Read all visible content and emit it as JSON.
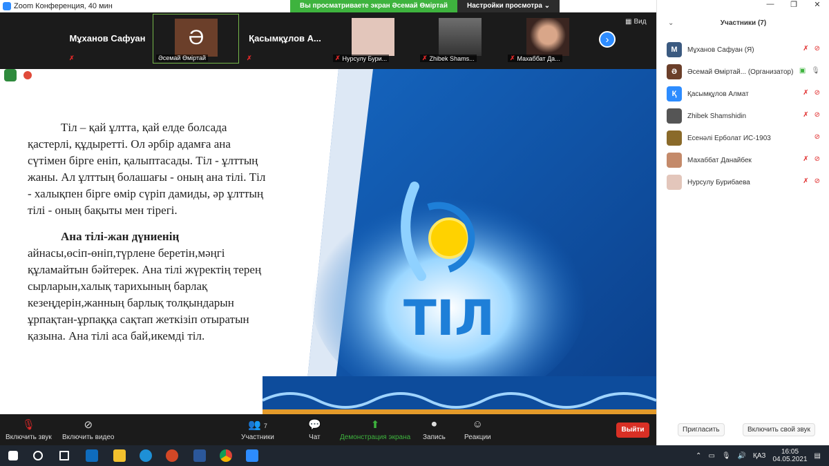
{
  "window": {
    "title": "Zoom Конференция, 40 мин",
    "share_notice": "Вы просматриваете экран Әсемай Өміртай",
    "view_settings": "Настройки просмотра",
    "view_label": "Вид"
  },
  "tiles": [
    {
      "name": "Мұханов Сафуан",
      "label": ""
    },
    {
      "label": "Әсемай Өміртай",
      "avatar": "Ә"
    },
    {
      "name": "Қасымқұлов А...",
      "label": ""
    },
    {
      "label": "Нурсулу Бури..."
    },
    {
      "label": "Zhibek Shams..."
    },
    {
      "label": "Махаббат Да..."
    }
  ],
  "slide": {
    "paragraph1": "Тіл – қай ұлтта, қай елде болсада қастерлі, құдыретті. Ол әрбір адамға ана сүтімен бірге еніп, қалыптасады.    Тіл - ұлттың жаны. Ал ұлттың болашағы - оның ана тілі. Тіл - халықпен бірге өмір сүріп дамиды, әр ұлттың тілі - оның бақыты мен тірегі.",
    "paragraph2_bold": "Ана тілі-жан дүниенің",
    "paragraph2_rest": "айнасы,өсіп-өніп,түрлене беретін,мәңгі құламайтын бәйтерек. Ана тілі жүректің терең сырларын,халық тарихының барлақ кезеңдерін,жанның барлық толқындарын ұрпақтан-ұрпаққа сақтап жеткізіп отыратын қазына. Ана тілі аса бай,икемді тіл.",
    "logo_text": "ТІЛ"
  },
  "toolbar": {
    "mute": "Включить звук",
    "video": "Включить видео",
    "participants": "Участники",
    "participants_count": "7",
    "chat": "Чат",
    "share": "Демонстрация экрана",
    "record": "Запись",
    "reactions": "Реакции",
    "leave": "Выйти"
  },
  "panel": {
    "title": "Участники (7)",
    "participants": [
      {
        "initial": "М",
        "name": "Мұханов Сафуан (Я)",
        "color": "#3b5a80"
      },
      {
        "initial": "Ә",
        "name": "Әсемай Өміртай... (Организатор)",
        "color": "#6b3f2a"
      },
      {
        "initial": "Қ",
        "name": "Қасымқұлов Алмат",
        "color": "#2d8cff"
      },
      {
        "initial": "",
        "name": "Zhibek Shamshidin",
        "color": "#555555"
      },
      {
        "initial": "",
        "name": "Есенәлі Ерболат ИС-1903",
        "color": "#8a6a2a"
      },
      {
        "initial": "",
        "name": "Махаббат Данайбек",
        "color": "#c48a6a"
      },
      {
        "initial": "",
        "name": "Нурсулу Бурибаева",
        "color": "#e3c6bb"
      }
    ],
    "invite": "Пригласить",
    "unmute_me": "Включить свой звук"
  },
  "taskbar": {
    "lang": "ҚАЗ",
    "time": "16:05",
    "date": "04.05.2021"
  }
}
